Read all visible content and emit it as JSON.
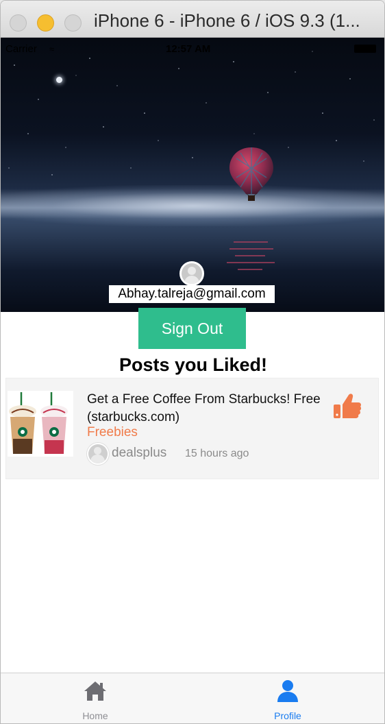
{
  "window": {
    "title": "iPhone 6 - iPhone 6 / iOS 9.3 (1..."
  },
  "status_bar": {
    "carrier": "Carrier",
    "time": "12:57 AM"
  },
  "profile": {
    "email": "Abhay.talreja@gmail.com",
    "sign_out_label": "Sign Out"
  },
  "section": {
    "title": "Posts you Liked!"
  },
  "posts": [
    {
      "title": "Get a Free Coffee From Starbucks! Free (starbucks.com)",
      "category": "Freebies",
      "poster": "dealsplus",
      "time_ago": "15 hours ago"
    }
  ],
  "tab_bar": {
    "items": [
      {
        "label": "Home",
        "icon": "home-icon",
        "selected": false
      },
      {
        "label": "Profile",
        "icon": "person-icon",
        "selected": true
      }
    ]
  },
  "colors": {
    "accent_green": "#2fbd8d",
    "category_orange": "#f07b4a",
    "like_orange": "#f07b4a",
    "tab_selected": "#1a7cf0",
    "tab_unselected": "#8e8e93"
  }
}
